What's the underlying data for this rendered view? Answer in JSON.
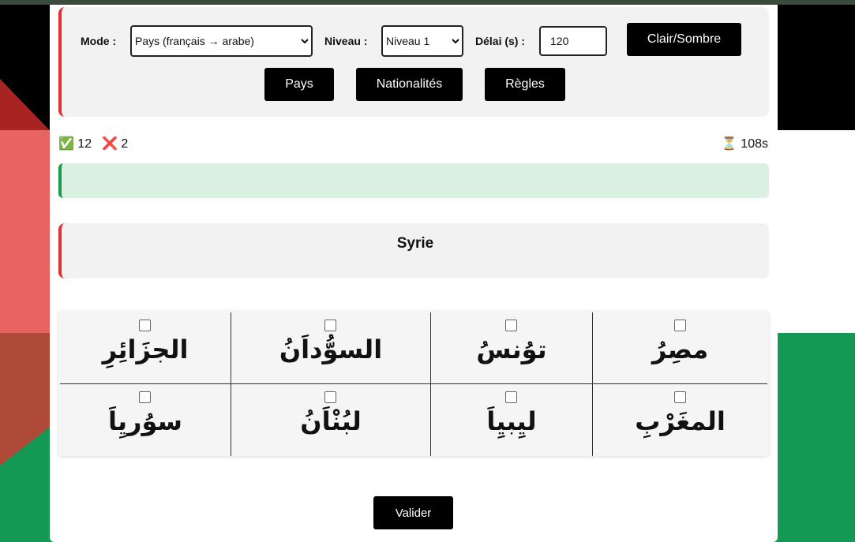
{
  "controls": {
    "mode_label": "Mode :",
    "mode_value": "Pays (français → arabe)",
    "level_label": "Niveau :",
    "level_value": "Niveau 1",
    "delay_label": "Délai (s) :",
    "delay_value": "120",
    "theme_button": "Clair/Sombre",
    "countries_button": "Pays",
    "nationalities_button": "Nationalités",
    "rules_button": "Règles"
  },
  "stats": {
    "correct_icon": "✅",
    "correct_count": "12",
    "wrong_icon": "❌",
    "wrong_count": "2",
    "timer_icon": "⏳",
    "timer_value": "108s"
  },
  "question": {
    "prompt": "Syrie"
  },
  "answers": [
    "الجزَائِرِ",
    "السوُّداَنُ",
    "توُنسُ",
    "مصِرُ",
    "سوُريِاَ",
    "لبُنْاَنُ",
    "ليِبيِاَ",
    "المغَرْبِ"
  ],
  "submit_label": "Valider",
  "colors": {
    "flag_black": "#000000",
    "flag_white": "#ffffff",
    "flag_green": "#149954",
    "flag_red": "#e0302f",
    "feedback_bg": "#d9f0e2"
  }
}
